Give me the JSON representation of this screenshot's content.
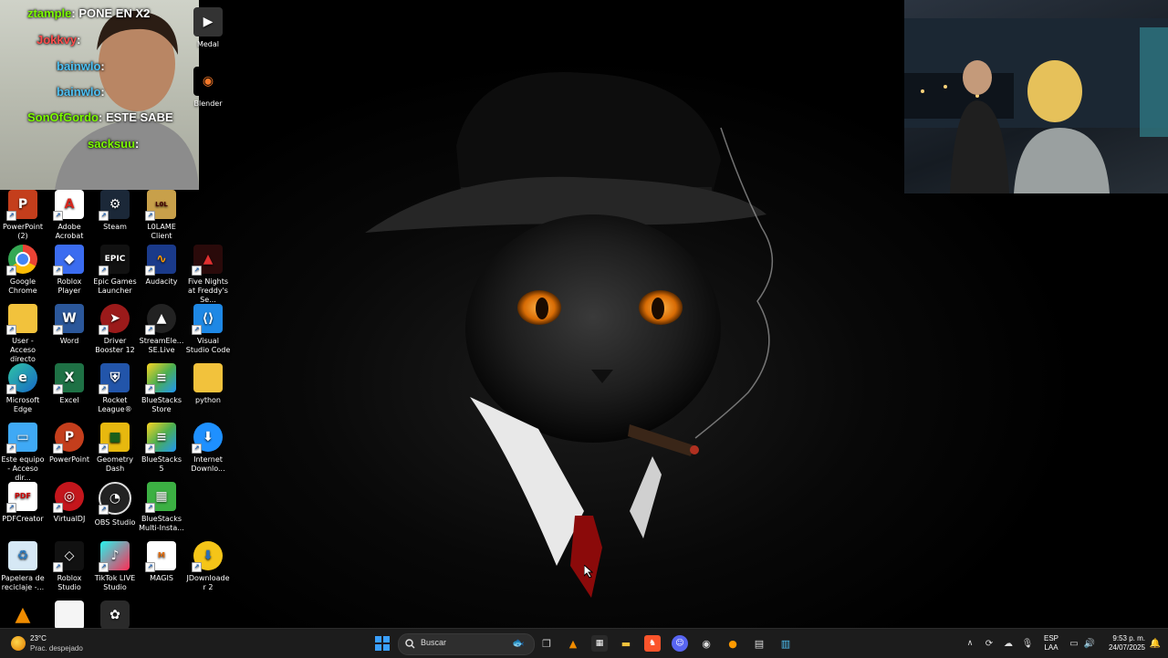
{
  "chat": [
    {
      "user": "ztample",
      "message": ": PONE EN X2"
    },
    {
      "user": "Jokkvy",
      "message": ":"
    },
    {
      "user": "bainwlo",
      "message": ":"
    },
    {
      "user": "bainwlo",
      "message": ":"
    },
    {
      "user": "SonOfGordo",
      "message": ": ESTE SABE"
    },
    {
      "user": "sacksuu",
      "message": ":"
    }
  ],
  "icons": {
    "medal": "Medal",
    "blender": "Blender",
    "powerpoint2": "PowerPoint (2)",
    "adobe": "Adobe Acrobat",
    "steam": "Steam",
    "lolame": "L0LAME Client",
    "chrome": "Google Chrome",
    "roblox_player": "Roblox Player",
    "epic": "Epic Games Launcher",
    "audacity": "Audacity",
    "fnaf": "Five Nights at Freddy's Se...",
    "user": "User - Acceso directo",
    "word": "Word",
    "driver": "Driver Booster 12",
    "streamelements": "StreamEle... SE.Live",
    "vscode": "Visual Studio Code",
    "edge": "Microsoft Edge",
    "excel": "Excel",
    "rocket": "Rocket League®",
    "bs_store": "BlueStacks Store",
    "python": "python",
    "este_equipo": "Este equipo - Acceso dir...",
    "powerpoint": "PowerPoint",
    "geometry": "Geometry Dash",
    "bs5": "BlueStacks 5",
    "idm": "Internet Downlo...",
    "pdfcreator": "PDFCreator",
    "virtualdj": "VirtualDJ",
    "obs": "OBS Studio",
    "bs_multi": "BlueStacks Multi-Insta...",
    "recycle": "Papelera de reciclaje -...",
    "roblox_studio": "Roblox Studio",
    "tiktok": "TikTok LIVE Studio",
    "magis": "MAGIS",
    "jdownloader": "JDownloader 2"
  },
  "taskbar": {
    "weather_temp": "23°C",
    "weather_desc": "Prac. despejado",
    "search_placeholder": "Buscar",
    "lang_top": "ESP",
    "lang_bottom": "LAA",
    "time": "9:53 p. m.",
    "date": "24/07/2025"
  },
  "colors": {
    "taskbar_bg": "#1c1c1c",
    "chat_user": "#7cfc00",
    "accent_windows": "#3aa0ff"
  }
}
